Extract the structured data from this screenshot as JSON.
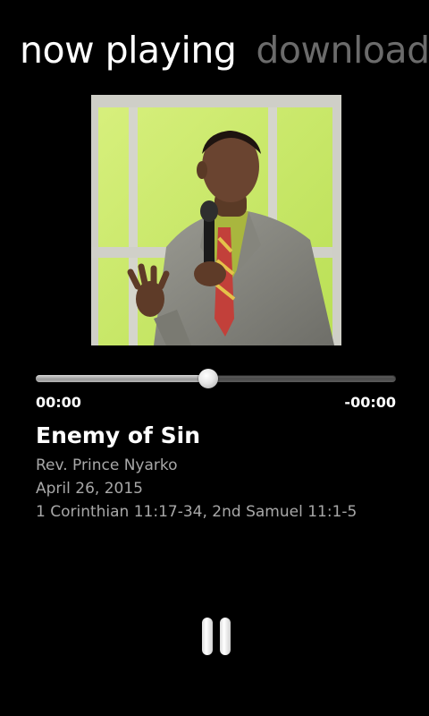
{
  "pivot": {
    "tabs": [
      {
        "label": "now playing",
        "active": true
      },
      {
        "label": "downloads",
        "active": false
      }
    ]
  },
  "player": {
    "artwork_icon": "sermon-artwork-image",
    "progress_fraction": 0.48,
    "elapsed": "00:00",
    "remaining": "-00:00",
    "pause_icon": "pause-icon"
  },
  "track": {
    "title": "Enemy of Sin",
    "speaker": "Rev. Prince Nyarko",
    "date": "April 26, 2015",
    "scripture": "1 Corinthian 11:17-34, 2nd Samuel 11:1-5"
  },
  "colors": {
    "background": "#000000",
    "active_tab": "#ffffff",
    "inactive_tab": "#6b6b6b",
    "meta_text": "#a8a8a8",
    "artwork_backdrop": "#c8e86a"
  }
}
